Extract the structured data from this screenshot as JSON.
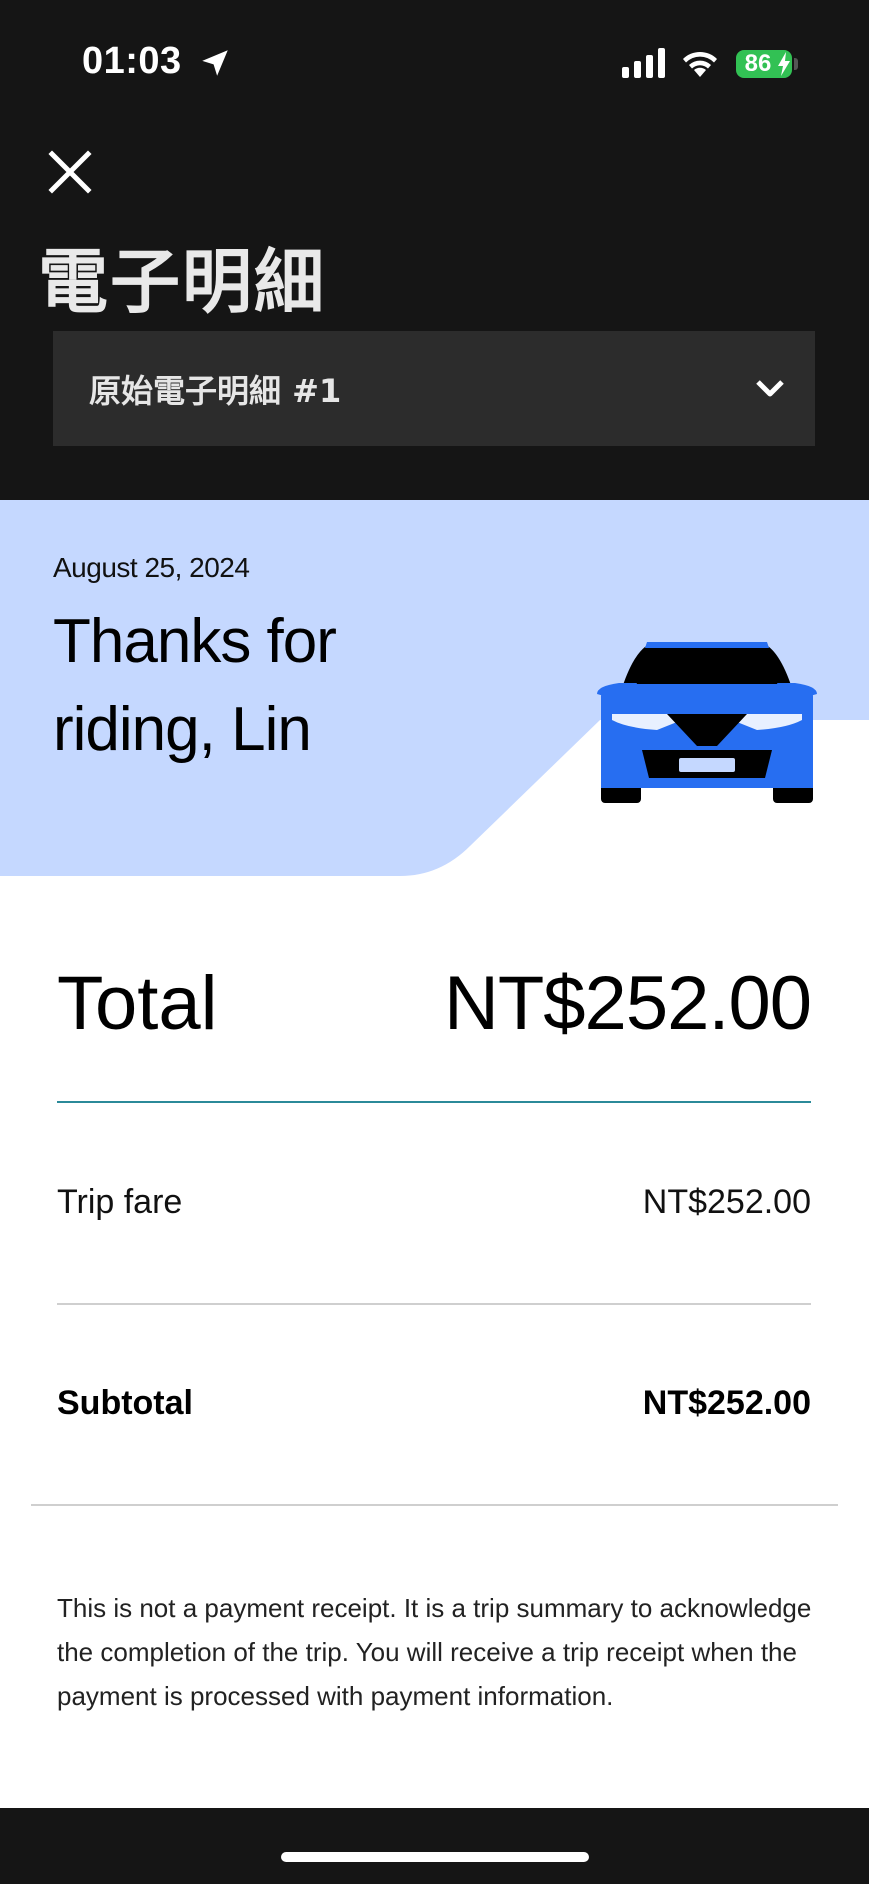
{
  "status_bar": {
    "time": "01:03",
    "battery": "86",
    "icons": [
      "location-arrow-icon",
      "signal-icon",
      "wifi-icon",
      "battery-charging-icon"
    ]
  },
  "header": {
    "close_icon": "close-icon",
    "title": "電子明細",
    "dropdown_label": "原始電子明細 #1",
    "dropdown_icon": "chevron-down-icon"
  },
  "hero": {
    "date": "August 25, 2024",
    "message": "Thanks for riding, Lin",
    "illustration": "car-icon",
    "colors": {
      "banner": "#c5d8ff",
      "car": "#276ef1"
    }
  },
  "summary": {
    "total_label": "Total",
    "total_value": "NT$252.00",
    "rows": [
      {
        "label": "Trip fare",
        "value": "NT$252.00"
      }
    ],
    "subtotal_label": "Subtotal",
    "subtotal_value": "NT$252.00"
  },
  "disclaimer": "This is not a payment receipt. It is a trip summary to acknowledge the completion of the trip. You will receive a trip receipt when the payment is processed with payment information.",
  "colors": {
    "dark_bg": "#151515",
    "divider_accent": "#2b8a99"
  }
}
